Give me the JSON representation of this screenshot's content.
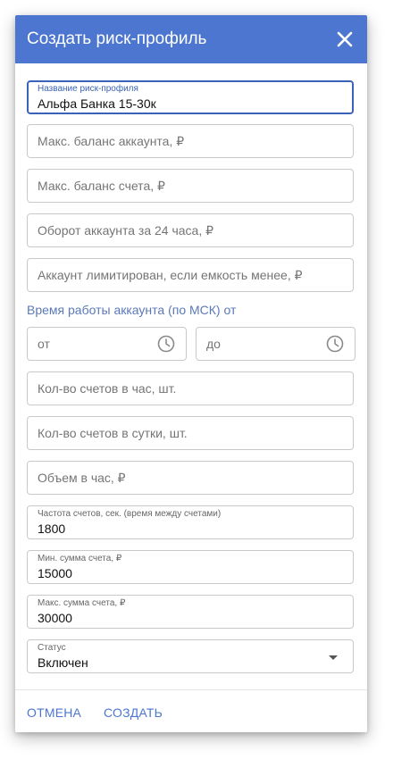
{
  "dialog": {
    "title": "Создать риск-профиль",
    "close_icon": "close-icon"
  },
  "fields": {
    "profile_name": {
      "label": "Название риск-профиля",
      "value": "Альфа Банка 15-30к"
    },
    "max_account_balance": {
      "placeholder": "Макс. баланс аккаунта, ₽"
    },
    "max_invoice_balance": {
      "placeholder": "Макс. баланс счета, ₽"
    },
    "account_turnover_24h": {
      "placeholder": "Оборот аккаунта за 24 часа, ₽"
    },
    "account_limited": {
      "placeholder": "Аккаунт лимитирован, если емкость менее, ₽"
    },
    "work_time_label": "Время работы аккаунта (по МСК) от",
    "time_from": {
      "placeholder": "от",
      "icon": "clock-icon"
    },
    "time_to": {
      "placeholder": "до",
      "icon": "clock-icon"
    },
    "invoices_per_hour": {
      "placeholder": "Кол-во счетов в час, шт."
    },
    "invoices_per_day": {
      "placeholder": "Кол-во счетов в сутки, шт."
    },
    "volume_per_hour": {
      "placeholder": "Объем в час, ₽"
    },
    "invoice_frequency": {
      "label": "Частота счетов, сек. (время между счетами)",
      "value": "1800"
    },
    "min_invoice_sum": {
      "label": "Мин. сумма счета, ₽",
      "value": "15000"
    },
    "max_invoice_sum": {
      "label": "Макс. сумма счета, ₽",
      "value": "30000"
    },
    "status": {
      "label": "Статус",
      "value": "Включен",
      "icon": "dropdown-arrow-icon"
    }
  },
  "actions": {
    "cancel": "ОТМЕНА",
    "create": "СОЗДАТЬ"
  },
  "colors": {
    "header": "#4c76cf",
    "accent": "#3a63b8",
    "border": "#c9c9c9"
  }
}
